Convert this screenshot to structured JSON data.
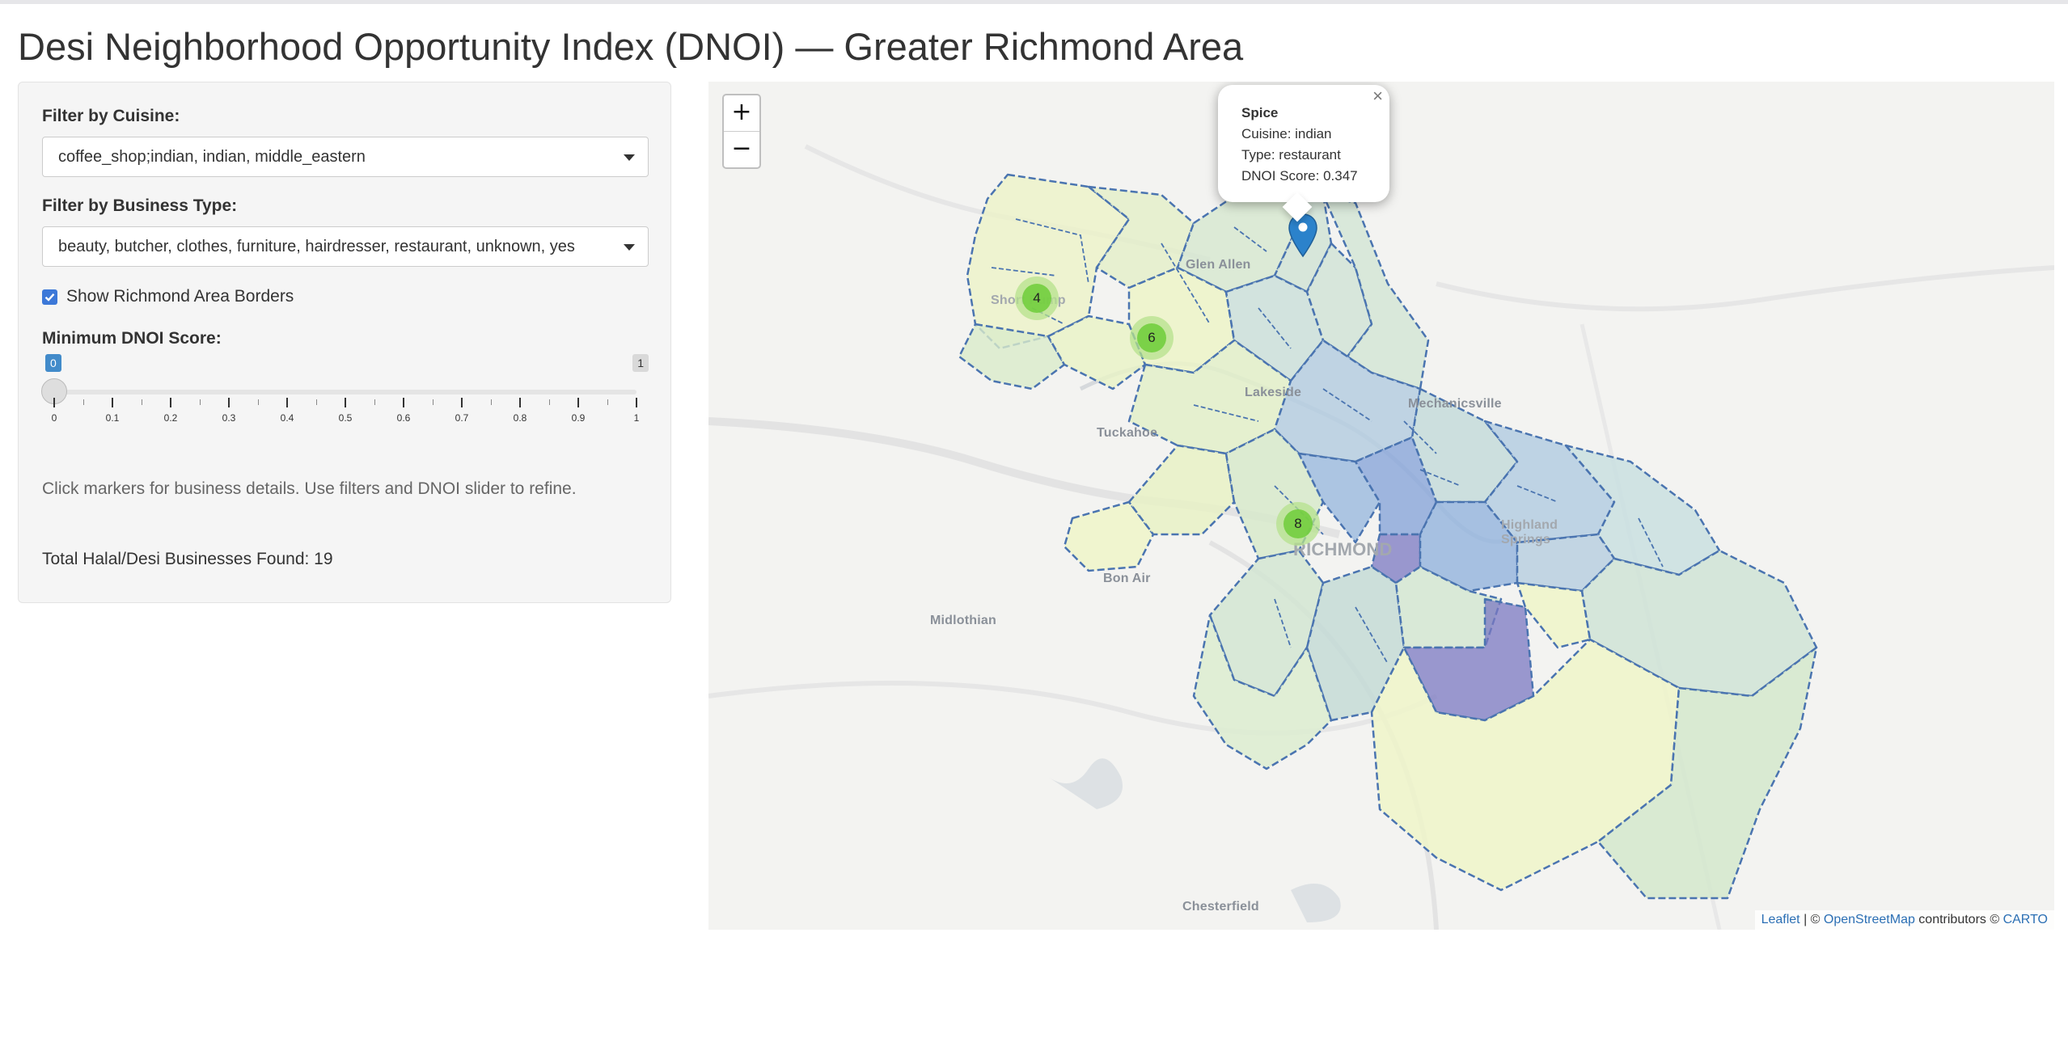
{
  "page": {
    "title": "Desi Neighborhood Opportunity Index (DNOI) — Greater Richmond Area"
  },
  "sidebar": {
    "cuisine_label": "Filter by Cuisine:",
    "cuisine_value": "coffee_shop;indian, indian, middle_eastern",
    "business_type_label": "Filter by Business Type:",
    "business_type_value": "beauty, butcher, clothes, furniture, hairdresser, restaurant, unknown, yes",
    "borders_checkbox_label": "Show Richmond Area Borders",
    "borders_checked": true,
    "slider_label": "Minimum DNOI Score:",
    "slider": {
      "min": 0,
      "max": 1,
      "value": 0,
      "min_badge": "0",
      "max_badge": "1",
      "ticks": [
        "0",
        "0.1",
        "0.2",
        "0.3",
        "0.4",
        "0.5",
        "0.6",
        "0.7",
        "0.8",
        "0.9",
        "1"
      ]
    },
    "help_text": "Click markers for business details. Use filters and DNOI slider to refine.",
    "total_text": "Total Halal/Desi Businesses Found: 19"
  },
  "map": {
    "zoom_in": "+",
    "zoom_out": "−",
    "popup": {
      "name": "Spice",
      "close": "×",
      "cuisine": "Cuisine: indian",
      "type": "Type: restaurant",
      "score": "DNOI Score: 0.347"
    },
    "clusters": [
      {
        "count": "4"
      },
      {
        "count": "6"
      },
      {
        "count": "8"
      }
    ],
    "place_labels": {
      "glen_allen": "Glen Allen",
      "short_pump": "Short Pump",
      "lakeside": "Lakeside",
      "mechanicsville": "Mechanicsville",
      "tuckahoe": "Tuckahoe",
      "highland_springs": "Highland Springs",
      "richmond": "RICHMOND",
      "bon_air": "Bon Air",
      "midlothian": "Midlothian",
      "chesterfield": "Chesterfield"
    },
    "attribution": {
      "leaflet": "Leaflet",
      "sep": " | © ",
      "osm": "OpenStreetMap",
      "contrib": " contributors © ",
      "carto": "CARTO"
    },
    "colors": {
      "boundary": "#4a74b0",
      "low_score": "#eef5c9",
      "mid_low": "#d9ecc8",
      "mid": "#c9e2d6",
      "mid_high": "#9fbcdf",
      "high": "#7b78c2",
      "cluster": "#6ecc39",
      "marker": "#2b82cb"
    }
  }
}
